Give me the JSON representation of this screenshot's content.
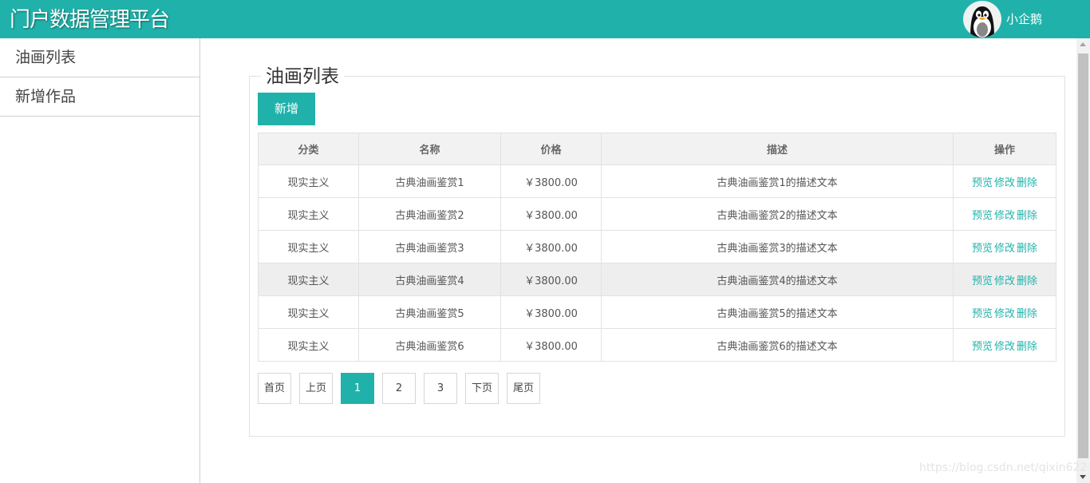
{
  "header": {
    "title": "门户数据管理平台",
    "username": "小企鹅",
    "accent_color": "#20B2AA",
    "avatar_icon": "penguin-avatar-icon"
  },
  "sidebar": {
    "items": [
      {
        "label": "油画列表"
      },
      {
        "label": "新增作品"
      }
    ]
  },
  "main": {
    "legend": "油画列表",
    "add_button": "新增",
    "columns": [
      "分类",
      "名称",
      "价格",
      "描述",
      "操作"
    ],
    "rows": [
      {
        "category": "现实主义",
        "name": "古典油画鉴赏1",
        "price": "￥3800.00",
        "desc": "古典油画鉴赏1的描述文本"
      },
      {
        "category": "现实主义",
        "name": "古典油画鉴赏2",
        "price": "￥3800.00",
        "desc": "古典油画鉴赏2的描述文本"
      },
      {
        "category": "现实主义",
        "name": "古典油画鉴赏3",
        "price": "￥3800.00",
        "desc": "古典油画鉴赏3的描述文本"
      },
      {
        "category": "现实主义",
        "name": "古典油画鉴赏4",
        "price": "￥3800.00",
        "desc": "古典油画鉴赏4的描述文本"
      },
      {
        "category": "现实主义",
        "name": "古典油画鉴赏5",
        "price": "￥3800.00",
        "desc": "古典油画鉴赏5的描述文本"
      },
      {
        "category": "现实主义",
        "name": "古典油画鉴赏6",
        "price": "￥3800.00",
        "desc": "古典油画鉴赏6的描述文本"
      }
    ],
    "highlighted_row": 4,
    "actions": {
      "preview": "预览",
      "edit": "修改",
      "delete": "删除"
    },
    "pagination": {
      "first": "首页",
      "prev": "上页",
      "pages": [
        "1",
        "2",
        "3"
      ],
      "current_page": "1",
      "next": "下页",
      "last": "尾页"
    }
  },
  "watermark": "https://blog.csdn.net/qixin622"
}
